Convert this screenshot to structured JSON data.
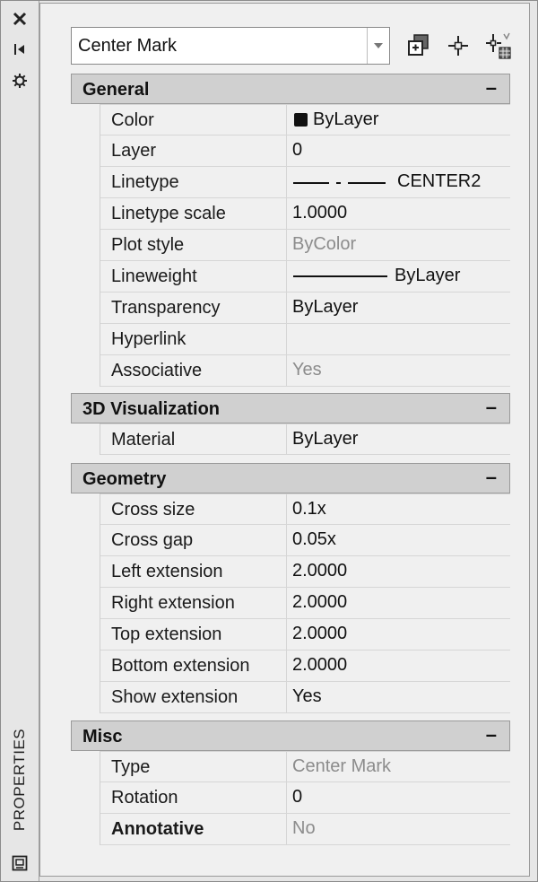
{
  "palette": {
    "title": "PROPERTIES"
  },
  "selector": {
    "value": "Center Mark"
  },
  "sections": {
    "general": {
      "title": "General",
      "collapse": "–",
      "rows": {
        "color": {
          "label": "Color",
          "value": "ByLayer"
        },
        "layer": {
          "label": "Layer",
          "value": "0"
        },
        "linetype": {
          "label": "Linetype",
          "value": "CENTER2"
        },
        "linetype_scale": {
          "label": "Linetype scale",
          "value": "1.0000"
        },
        "plot_style": {
          "label": "Plot style",
          "value": "ByColor"
        },
        "lineweight": {
          "label": "Lineweight",
          "value": "ByLayer"
        },
        "transparency": {
          "label": "Transparency",
          "value": "ByLayer"
        },
        "hyperlink": {
          "label": "Hyperlink",
          "value": ""
        },
        "associative": {
          "label": "Associative",
          "value": "Yes"
        }
      }
    },
    "visualization": {
      "title": "3D Visualization",
      "collapse": "–",
      "rows": {
        "material": {
          "label": "Material",
          "value": "ByLayer"
        }
      }
    },
    "geometry": {
      "title": "Geometry",
      "collapse": "–",
      "rows": {
        "cross_size": {
          "label": "Cross size",
          "value": "0.1x"
        },
        "cross_gap": {
          "label": "Cross gap",
          "value": "0.05x"
        },
        "left_extension": {
          "label": "Left extension",
          "value": "2.0000"
        },
        "right_extension": {
          "label": "Right extension",
          "value": "2.0000"
        },
        "top_extension": {
          "label": "Top extension",
          "value": "2.0000"
        },
        "bottom_extension": {
          "label": "Bottom extension",
          "value": "2.0000"
        },
        "show_extension": {
          "label": "Show extension",
          "value": "Yes"
        }
      }
    },
    "misc": {
      "title": "Misc",
      "collapse": "–",
      "rows": {
        "type": {
          "label": "Type",
          "value": "Center Mark"
        },
        "rotation": {
          "label": "Rotation",
          "value": "0"
        },
        "annotative": {
          "label": "Annotative",
          "value": "No"
        }
      }
    }
  }
}
